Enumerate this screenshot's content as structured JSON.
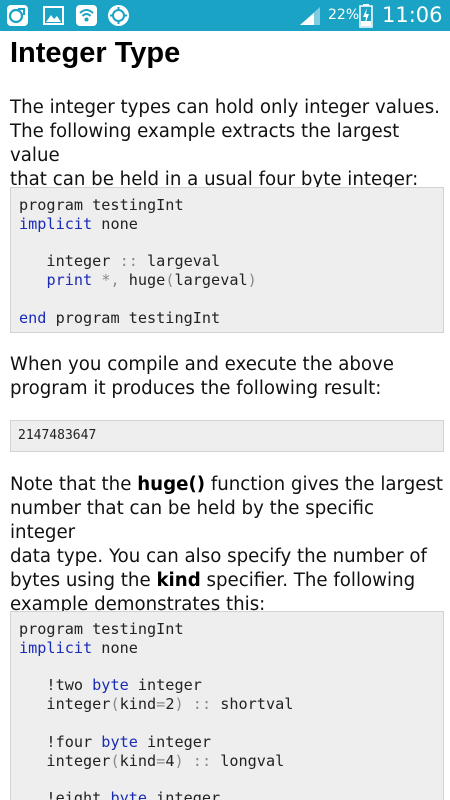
{
  "status_bar": {
    "battery_percent": "22%",
    "time": "11:06",
    "colors": {
      "background": "#1aa3c4",
      "foreground": "#ffffff"
    },
    "icons": [
      "app-notification-icon",
      "image-icon",
      "wifi-signal-icon",
      "sync-app-icon",
      "cellular-signal-icon",
      "battery-charging-icon"
    ]
  },
  "page": {
    "title": "Integer Type",
    "intro_lines": [
      "The integer types can hold only integer values.",
      "The following example extracts the largest value",
      "that can be held in a usual four byte integer:"
    ],
    "code_block_1": {
      "lines": [
        [
          {
            "t": "program testingInt",
            "c": "txt"
          }
        ],
        [
          {
            "t": "implicit",
            "c": "kw"
          },
          {
            "t": " none",
            "c": "txt"
          }
        ],
        [],
        [
          {
            "t": "   integer ",
            "c": "txt"
          },
          {
            "t": "::",
            "c": "op"
          },
          {
            "t": " largeval",
            "c": "txt"
          }
        ],
        [
          {
            "t": "   ",
            "c": "txt"
          },
          {
            "t": "print",
            "c": "kw"
          },
          {
            "t": " ",
            "c": "txt"
          },
          {
            "t": "*,",
            "c": "op"
          },
          {
            "t": " huge",
            "c": "txt"
          },
          {
            "t": "(",
            "c": "op"
          },
          {
            "t": "largeval",
            "c": "txt"
          },
          {
            "t": ")",
            "c": "op"
          }
        ],
        [],
        [
          {
            "t": "end",
            "c": "kw"
          },
          {
            "t": " program testingInt",
            "c": "txt"
          }
        ]
      ]
    },
    "result_lead_lines": [
      "When you compile and execute the above",
      "program it produces the following result:"
    ],
    "output_1": "2147483647",
    "note_lines": [
      [
        {
          "t": "Note that the ",
          "b": false
        },
        {
          "t": "huge()",
          "b": true
        },
        {
          "t": " function gives the largest",
          "b": false
        }
      ],
      [
        {
          "t": "number that can be held by the specific integer",
          "b": false
        }
      ],
      [
        {
          "t": "data type. You can also specify the number of",
          "b": false
        }
      ],
      [
        {
          "t": "bytes using the ",
          "b": false
        },
        {
          "t": "kind",
          "b": true
        },
        {
          "t": " specifier. The following",
          "b": false
        }
      ],
      [
        {
          "t": "example demonstrates this:",
          "b": false
        }
      ]
    ],
    "code_block_2": {
      "lines": [
        [
          {
            "t": "program testingInt",
            "c": "txt"
          }
        ],
        [
          {
            "t": "implicit",
            "c": "kw"
          },
          {
            "t": " none",
            "c": "txt"
          }
        ],
        [],
        [
          {
            "t": "   !two ",
            "c": "txt"
          },
          {
            "t": "byte",
            "c": "kw"
          },
          {
            "t": " integer",
            "c": "txt"
          }
        ],
        [
          {
            "t": "   integer",
            "c": "txt"
          },
          {
            "t": "(",
            "c": "op"
          },
          {
            "t": "kind",
            "c": "txt"
          },
          {
            "t": "=",
            "c": "op"
          },
          {
            "t": "2",
            "c": "txt"
          },
          {
            "t": ")",
            "c": "op"
          },
          {
            "t": " ",
            "c": "txt"
          },
          {
            "t": "::",
            "c": "op"
          },
          {
            "t": " shortval",
            "c": "txt"
          }
        ],
        [],
        [
          {
            "t": "   !four ",
            "c": "txt"
          },
          {
            "t": "byte",
            "c": "kw"
          },
          {
            "t": " integer",
            "c": "txt"
          }
        ],
        [
          {
            "t": "   integer",
            "c": "txt"
          },
          {
            "t": "(",
            "c": "op"
          },
          {
            "t": "kind",
            "c": "txt"
          },
          {
            "t": "=",
            "c": "op"
          },
          {
            "t": "4",
            "c": "txt"
          },
          {
            "t": ")",
            "c": "op"
          },
          {
            "t": " ",
            "c": "txt"
          },
          {
            "t": "::",
            "c": "op"
          },
          {
            "t": " longval",
            "c": "txt"
          }
        ],
        [],
        [
          {
            "t": "   !eight ",
            "c": "txt"
          },
          {
            "t": "byte",
            "c": "kw"
          },
          {
            "t": " integer",
            "c": "txt"
          }
        ]
      ]
    }
  }
}
